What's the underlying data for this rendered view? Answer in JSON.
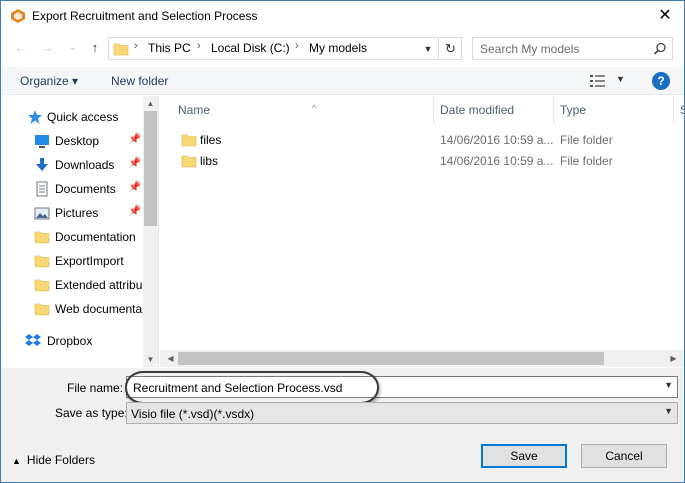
{
  "window": {
    "title": "Export Recruitment and Selection Process",
    "close_label": "✕"
  },
  "navigation": {
    "back_icon": "←",
    "forward_icon": "→",
    "recent_icon": "⌄",
    "up_icon": "↑",
    "breadcrumb": [
      "This PC",
      "Local Disk (C:)",
      "My models"
    ],
    "refresh_icon": "↻",
    "search_placeholder": "Search My models"
  },
  "toolbar": {
    "organize_label": "Organize ▾",
    "new_folder_label": "New folder",
    "help_label": "?"
  },
  "sidebar": {
    "items": [
      {
        "label": "Quick access",
        "icon": "star-icon",
        "pinned": false
      },
      {
        "label": "Desktop",
        "icon": "desktop-icon",
        "pinned": true
      },
      {
        "label": "Downloads",
        "icon": "download-icon",
        "pinned": true
      },
      {
        "label": "Documents",
        "icon": "documents-icon",
        "pinned": true
      },
      {
        "label": "Pictures",
        "icon": "pictures-icon",
        "pinned": true
      },
      {
        "label": "Documentation",
        "icon": "folder-icon",
        "pinned": false
      },
      {
        "label": "ExportImport",
        "icon": "folder-icon",
        "pinned": false
      },
      {
        "label": "Extended attribu",
        "icon": "folder-icon",
        "pinned": false
      },
      {
        "label": "Web documenta",
        "icon": "folder-icon",
        "pinned": false
      },
      {
        "label": "Dropbox",
        "icon": "dropbox-icon",
        "pinned": false
      }
    ]
  },
  "file_list": {
    "columns": [
      "Name",
      "Date modified",
      "Type",
      "S"
    ],
    "rows": [
      {
        "name": "files",
        "date": "14/06/2016 10:59 a...",
        "type": "File folder"
      },
      {
        "name": "libs",
        "date": "14/06/2016 10:59 a...",
        "type": "File folder"
      }
    ]
  },
  "form": {
    "file_name_label": "File name:",
    "file_name_value": "Recruitment and Selection Process.vsd",
    "save_type_label": "Save as type:",
    "save_type_value": "Visio file (*.vsd)(*.vsdx)"
  },
  "footer": {
    "hide_folders_label": "Hide Folders",
    "save_label": "Save",
    "cancel_label": "Cancel"
  },
  "colors": {
    "accent": "#0078d7",
    "help": "#1b6fc3",
    "folder": "#f8d775"
  }
}
